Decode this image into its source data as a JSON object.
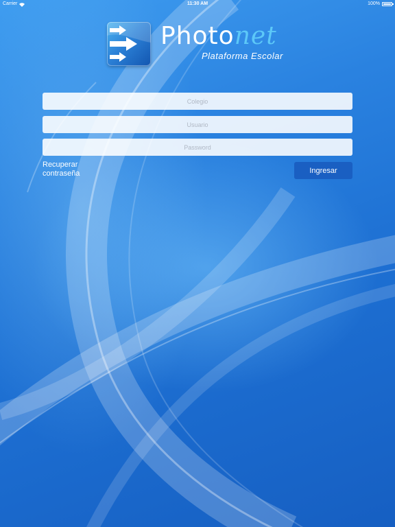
{
  "status_bar": {
    "carrier": "Carrier",
    "time": "11:30 AM",
    "battery": "100%"
  },
  "logo": {
    "brand_main": "Photo",
    "brand_accent": "net",
    "tagline": "Plataforma Escolar"
  },
  "form": {
    "school_placeholder": "Colegio",
    "user_placeholder": "Usuario",
    "password_placeholder": "Password",
    "recover_label": "Recuperar contraseña",
    "submit_label": "Ingresar"
  },
  "colors": {
    "background": "#1f6fd0",
    "button": "#1a5fc2",
    "brand_accent": "#5cc8f8"
  }
}
